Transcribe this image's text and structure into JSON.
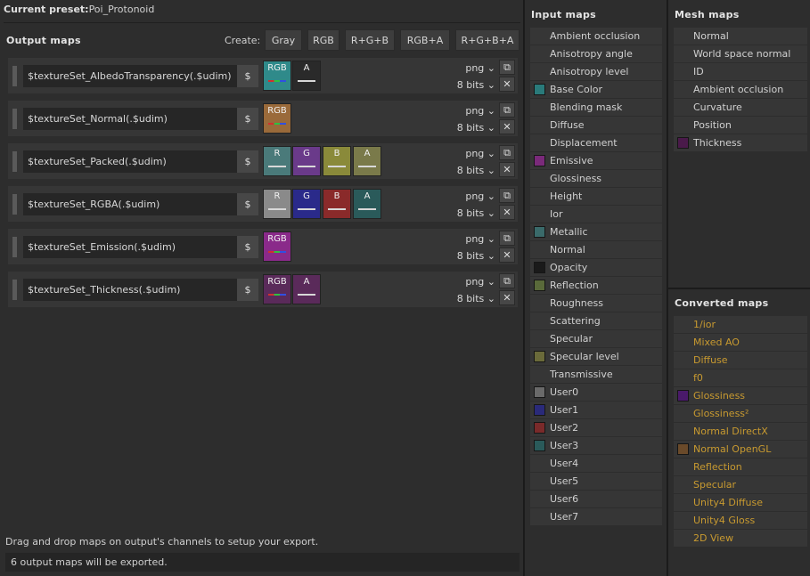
{
  "preset": {
    "label": "Current preset:",
    "value": "Poi_Protonoid"
  },
  "output_title": "Output maps",
  "create": {
    "label": "Create:",
    "buttons": [
      "Gray",
      "RGB",
      "R+G+B",
      "RGB+A",
      "R+G+B+A"
    ]
  },
  "output_maps": [
    {
      "name": "$textureSet_AlbedoTransparency(.$udim)",
      "dollar": "$",
      "format": "png",
      "bits": "8 bits",
      "channels": [
        {
          "label": "RGB",
          "color": "#2f8a8a",
          "bar": "rgb"
        },
        {
          "label": "A",
          "color": "#2a2a2a",
          "bar": "white"
        }
      ]
    },
    {
      "name": "$textureSet_Normal(.$udim)",
      "dollar": "$",
      "format": "png",
      "bits": "8 bits",
      "channels": [
        {
          "label": "RGB",
          "color": "#9a6a3a",
          "bar": "rgb"
        }
      ]
    },
    {
      "name": "$textureSet_Packed(.$udim)",
      "dollar": "$",
      "format": "png",
      "bits": "8 bits",
      "channels": [
        {
          "label": "R",
          "color": "#4a7a7a",
          "bar": "white"
        },
        {
          "label": "G",
          "color": "#6a3a8a",
          "bar": "white"
        },
        {
          "label": "B",
          "color": "#8a8a3a",
          "bar": "white"
        },
        {
          "label": "A",
          "color": "#7a7a4a",
          "bar": "white"
        }
      ]
    },
    {
      "name": "$textureSet_RGBA(.$udim)",
      "dollar": "$",
      "format": "png",
      "bits": "8 bits",
      "channels": [
        {
          "label": "R",
          "color": "#8a8a8a",
          "bar": "white"
        },
        {
          "label": "G",
          "color": "#2a2a8a",
          "bar": "white"
        },
        {
          "label": "B",
          "color": "#8a2a2a",
          "bar": "white"
        },
        {
          "label": "A",
          "color": "#2a5a5a",
          "bar": "white"
        }
      ]
    },
    {
      "name": "$textureSet_Emission(.$udim)",
      "dollar": "$",
      "format": "png",
      "bits": "8 bits",
      "channels": [
        {
          "label": "RGB",
          "color": "#8a2a8a",
          "bar": "rgb"
        }
      ]
    },
    {
      "name": "$textureSet_Thickness(.$udim)",
      "dollar": "$",
      "format": "png",
      "bits": "8 bits",
      "channels": [
        {
          "label": "RGB",
          "color": "#5a2a5a",
          "bar": "rgb"
        },
        {
          "label": "A",
          "color": "#5a2a5a",
          "bar": "white"
        }
      ]
    }
  ],
  "hint": "Drag and drop maps on output's channels to setup your export.",
  "status": "6 output maps will be exported.",
  "input_maps": {
    "title": "Input maps",
    "items": [
      {
        "label": "Ambient occlusion",
        "swatch": ""
      },
      {
        "label": "Anisotropy angle",
        "swatch": ""
      },
      {
        "label": "Anisotropy level",
        "swatch": ""
      },
      {
        "label": "Base Color",
        "swatch": "#2a7a7a"
      },
      {
        "label": "Blending mask",
        "swatch": ""
      },
      {
        "label": "Diffuse",
        "swatch": ""
      },
      {
        "label": "Displacement",
        "swatch": ""
      },
      {
        "label": "Emissive",
        "swatch": "#7a2a7a"
      },
      {
        "label": "Glossiness",
        "swatch": ""
      },
      {
        "label": "Height",
        "swatch": ""
      },
      {
        "label": "Ior",
        "swatch": ""
      },
      {
        "label": "Metallic",
        "swatch": "#3a6a6a"
      },
      {
        "label": "Normal",
        "swatch": ""
      },
      {
        "label": "Opacity",
        "swatch": "#1a1a1a"
      },
      {
        "label": "Reflection",
        "swatch": "#5a6a3a"
      },
      {
        "label": "Roughness",
        "swatch": ""
      },
      {
        "label": "Scattering",
        "swatch": ""
      },
      {
        "label": "Specular",
        "swatch": ""
      },
      {
        "label": "Specular level",
        "swatch": "#6a6a3a"
      },
      {
        "label": "Transmissive",
        "swatch": ""
      },
      {
        "label": "User0",
        "swatch": "#6a6a6a"
      },
      {
        "label": "User1",
        "swatch": "#2a2a7a"
      },
      {
        "label": "User2",
        "swatch": "#7a2a2a"
      },
      {
        "label": "User3",
        "swatch": "#2a5a5a"
      },
      {
        "label": "User4",
        "swatch": ""
      },
      {
        "label": "User5",
        "swatch": ""
      },
      {
        "label": "User6",
        "swatch": ""
      },
      {
        "label": "User7",
        "swatch": ""
      }
    ]
  },
  "mesh_maps": {
    "title": "Mesh maps",
    "items": [
      {
        "label": "Normal",
        "swatch": ""
      },
      {
        "label": "World space normal",
        "swatch": ""
      },
      {
        "label": "ID",
        "swatch": ""
      },
      {
        "label": "Ambient occlusion",
        "swatch": ""
      },
      {
        "label": "Curvature",
        "swatch": ""
      },
      {
        "label": "Position",
        "swatch": ""
      },
      {
        "label": "Thickness",
        "swatch": "#4a1a4a"
      }
    ]
  },
  "converted_maps": {
    "title": "Converted maps",
    "text_color": "#c89a30",
    "items": [
      {
        "label": "1/ior",
        "swatch": ""
      },
      {
        "label": "Mixed AO",
        "swatch": ""
      },
      {
        "label": "Diffuse",
        "swatch": ""
      },
      {
        "label": "f0",
        "swatch": ""
      },
      {
        "label": "Glossiness",
        "swatch": "#4a1a6a"
      },
      {
        "label": "Glossiness²",
        "swatch": ""
      },
      {
        "label": "Normal DirectX",
        "swatch": ""
      },
      {
        "label": "Normal OpenGL",
        "swatch": "#6a4a2a"
      },
      {
        "label": "Reflection",
        "swatch": ""
      },
      {
        "label": "Specular",
        "swatch": ""
      },
      {
        "label": "Unity4 Diffuse",
        "swatch": ""
      },
      {
        "label": "Unity4 Gloss",
        "swatch": ""
      },
      {
        "label": "2D View",
        "swatch": ""
      }
    ]
  },
  "icons": {
    "dropdown": "chevron-down-icon",
    "copy": "copy-icon",
    "delete": "close-icon"
  }
}
